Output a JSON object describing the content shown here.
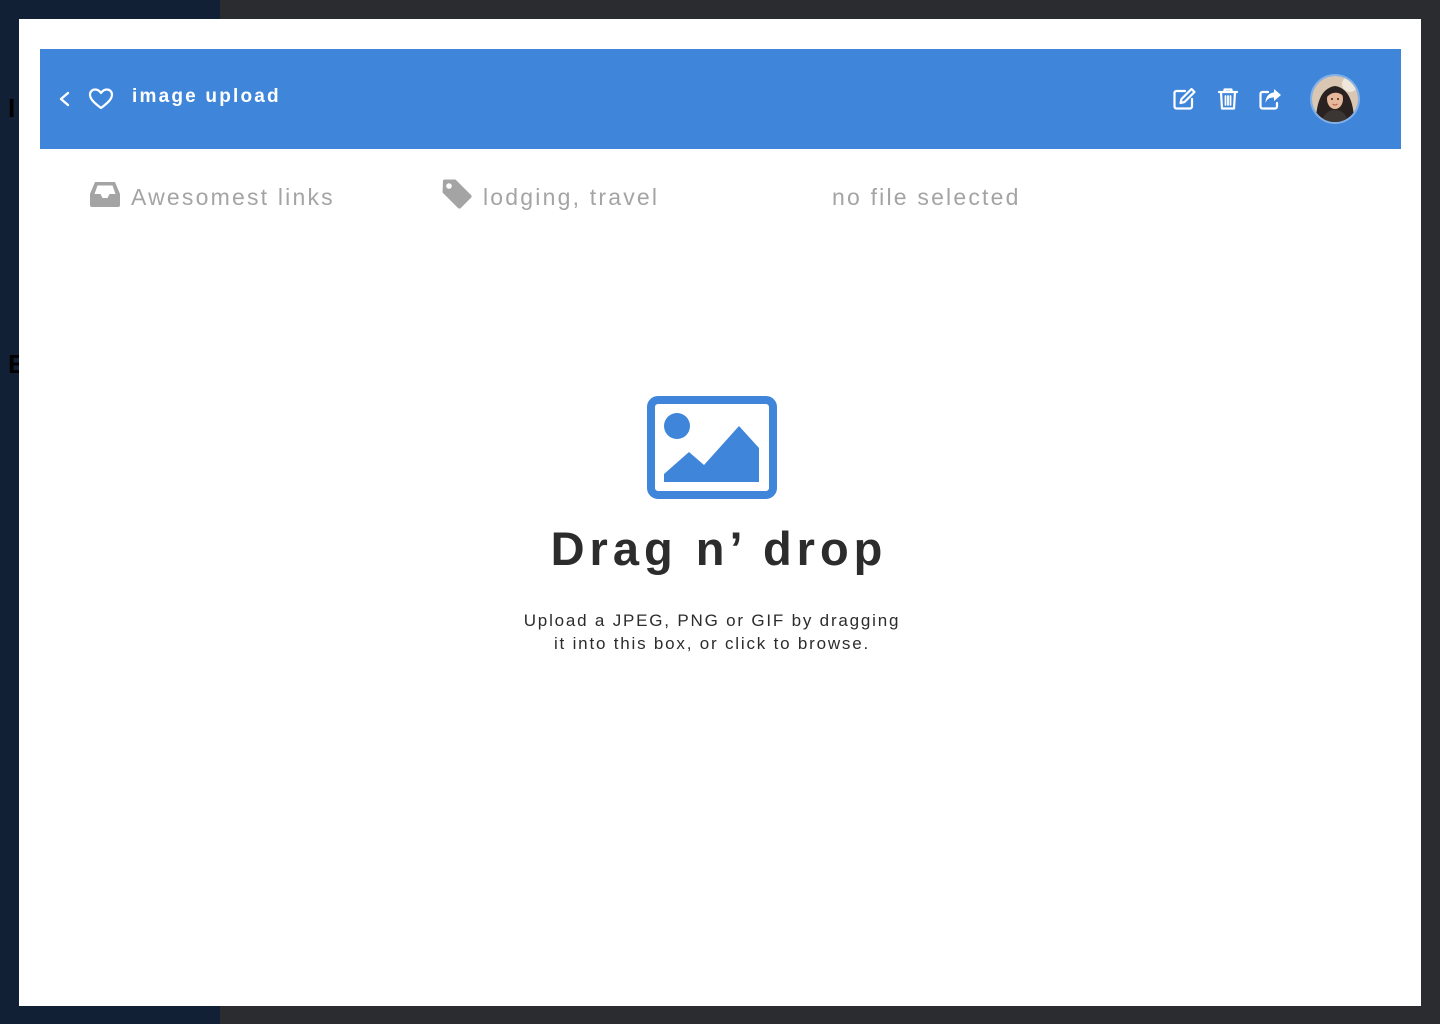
{
  "header": {
    "title": "image upload",
    "accent_color": "#3f86db",
    "icons": [
      "chevron-left-icon",
      "heart-icon",
      "edit-icon",
      "trash-icon",
      "share-icon"
    ]
  },
  "meta": {
    "collection": "Awesomest links",
    "tags": "lodging, travel",
    "file_status": "no file selected"
  },
  "dropzone": {
    "title": "Drag n’ drop",
    "subtitle_line1": "Upload a JPEG, PNG or GIF by dragging",
    "subtitle_line2": "it into this box, or click to browse.",
    "icon": "image-icon"
  },
  "backdrop": {
    "glyph_1": "I",
    "glyph_2": "E"
  }
}
